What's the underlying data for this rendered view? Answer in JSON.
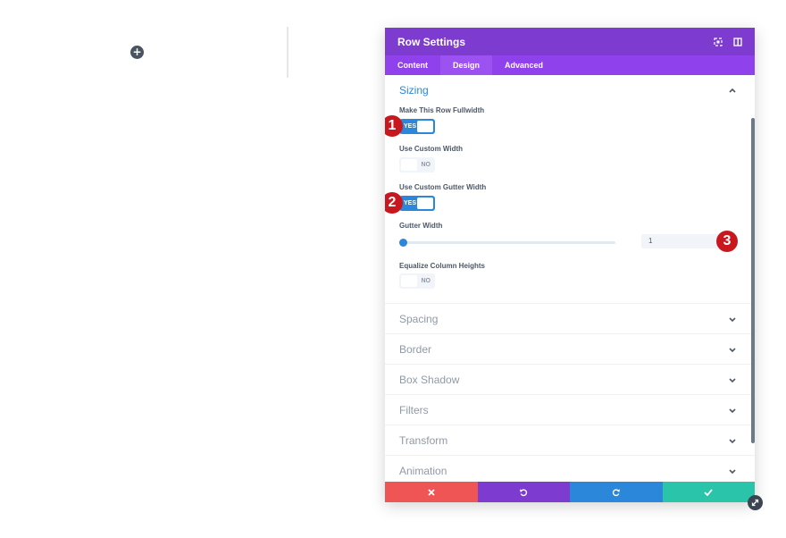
{
  "panel": {
    "title": "Row Settings",
    "tabs": [
      {
        "label": "Content",
        "active": false
      },
      {
        "label": "Design",
        "active": true
      },
      {
        "label": "Advanced",
        "active": false
      }
    ]
  },
  "sizing": {
    "title": "Sizing",
    "fields": {
      "fullwidth": {
        "label": "Make This Row Fullwidth",
        "value": "YES",
        "on": true
      },
      "custom_width": {
        "label": "Use Custom Width",
        "value": "NO",
        "on": false
      },
      "custom_gutter": {
        "label": "Use Custom Gutter Width",
        "value": "YES",
        "on": true
      },
      "gutter_width": {
        "label": "Gutter Width",
        "value": "1"
      },
      "equalize": {
        "label": "Equalize Column Heights",
        "value": "NO",
        "on": false
      }
    }
  },
  "collapsed_sections": [
    "Spacing",
    "Border",
    "Box Shadow",
    "Filters",
    "Transform",
    "Animation"
  ],
  "badges": [
    "1",
    "2",
    "3"
  ],
  "icons": {
    "add": "plus-icon",
    "fullscreen": "expand-icon",
    "sidebar": "sidebar-icon",
    "cancel": "close-icon",
    "undo": "undo-icon",
    "redo": "redo-icon",
    "save": "check-icon",
    "resize": "resize-icon"
  },
  "colors": {
    "header": "#7e3bd0",
    "tabs": "#8f42ec",
    "accent": "#2b87da",
    "cancel": "#ef5555",
    "save": "#29c4a9",
    "badge": "#c8181e"
  }
}
